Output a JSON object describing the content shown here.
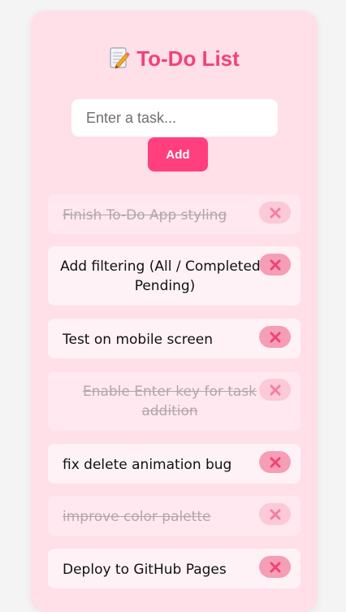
{
  "app": {
    "title": "To-Do List",
    "title_icon": "memo-icon"
  },
  "input": {
    "placeholder": "Enter a task...",
    "value": ""
  },
  "add_button": {
    "label": "Add"
  },
  "tasks": [
    {
      "text": "Finish To-Do App styling",
      "completed": true
    },
    {
      "text": "Add filtering (All / Completed / Pending)",
      "completed": false
    },
    {
      "text": "Test on mobile screen",
      "completed": false
    },
    {
      "text": "Enable Enter key for task addition",
      "completed": true
    },
    {
      "text": "fix delete animation bug",
      "completed": false
    },
    {
      "text": "improve color palette",
      "completed": true
    },
    {
      "text": "Deploy to GitHub Pages",
      "completed": false
    }
  ],
  "colors": {
    "accent": "#ff3f7e",
    "title": "#f0437a",
    "card": "#ffdfe8",
    "delete_icon": "#f0437a"
  }
}
